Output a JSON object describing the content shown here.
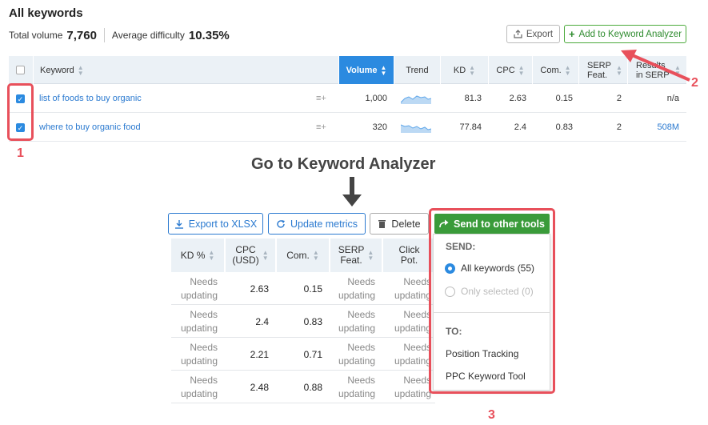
{
  "header": {
    "title": "All keywords",
    "total_volume_label": "Total volume",
    "total_volume_value": "7,760",
    "avg_difficulty_label": "Average difficulty",
    "avg_difficulty_value": "10.35%",
    "export_label": "Export",
    "add_label": "Add to Keyword Analyzer"
  },
  "top_table": {
    "columns": [
      "Keyword",
      "Volume",
      "Trend",
      "KD",
      "CPC",
      "Com.",
      "SERP Feat.",
      "Results in SERP"
    ],
    "rows": [
      {
        "keyword": "list of foods to buy organic",
        "volume": "1,000",
        "kd": "81.3",
        "cpc": "2.63",
        "com": "0.15",
        "serp": "2",
        "results": "n/a"
      },
      {
        "keyword": "where to buy organic food",
        "volume": "320",
        "kd": "77.84",
        "cpc": "2.4",
        "com": "0.83",
        "serp": "2",
        "results": "508M"
      }
    ]
  },
  "annotations": {
    "label_1": "1",
    "label_2": "2",
    "label_3": "3",
    "goto_heading": "Go to Keyword Analyzer"
  },
  "toolbar": {
    "export_xlsx": "Export to XLSX",
    "update_metrics": "Update metrics",
    "delete": "Delete",
    "send_to_other_tools": "Send to other tools"
  },
  "grid": {
    "columns": [
      "KD %",
      "CPC (USD)",
      "Com.",
      "SERP Feat.",
      "Click Pot."
    ],
    "col_cpc_line1": "CPC",
    "col_cpc_line2": "(USD)",
    "col_serp_line1": "SERP",
    "col_serp_line2": "Feat.",
    "col_click_line1": "Click",
    "col_click_line2": "Pot.",
    "rows": [
      {
        "kd": "Needs updating",
        "cpc": "2.63",
        "com": "0.15",
        "serp": "Needs updating",
        "click": "Needs updating"
      },
      {
        "kd": "Needs updating",
        "cpc": "2.4",
        "com": "0.83",
        "serp": "Needs updating",
        "click": "Needs updating"
      },
      {
        "kd": "Needs updating",
        "cpc": "2.21",
        "com": "0.71",
        "serp": "Needs updating",
        "click": "Needs updating"
      },
      {
        "kd": "Needs updating",
        "cpc": "2.48",
        "com": "0.88",
        "serp": "Needs updating",
        "click": "Needs updating"
      }
    ],
    "needs_line1": "Needs",
    "needs_line2": "updating"
  },
  "dropdown": {
    "send_label": "SEND:",
    "opt_all": "All keywords (55)",
    "opt_selected": "Only selected (0)",
    "to_label": "TO:",
    "target_1": "Position Tracking",
    "target_2": "PPC Keyword Tool"
  },
  "colors": {
    "accent_blue": "#2b8ae0",
    "green": "#3a9b3a",
    "annotation_red": "#e8505b"
  }
}
